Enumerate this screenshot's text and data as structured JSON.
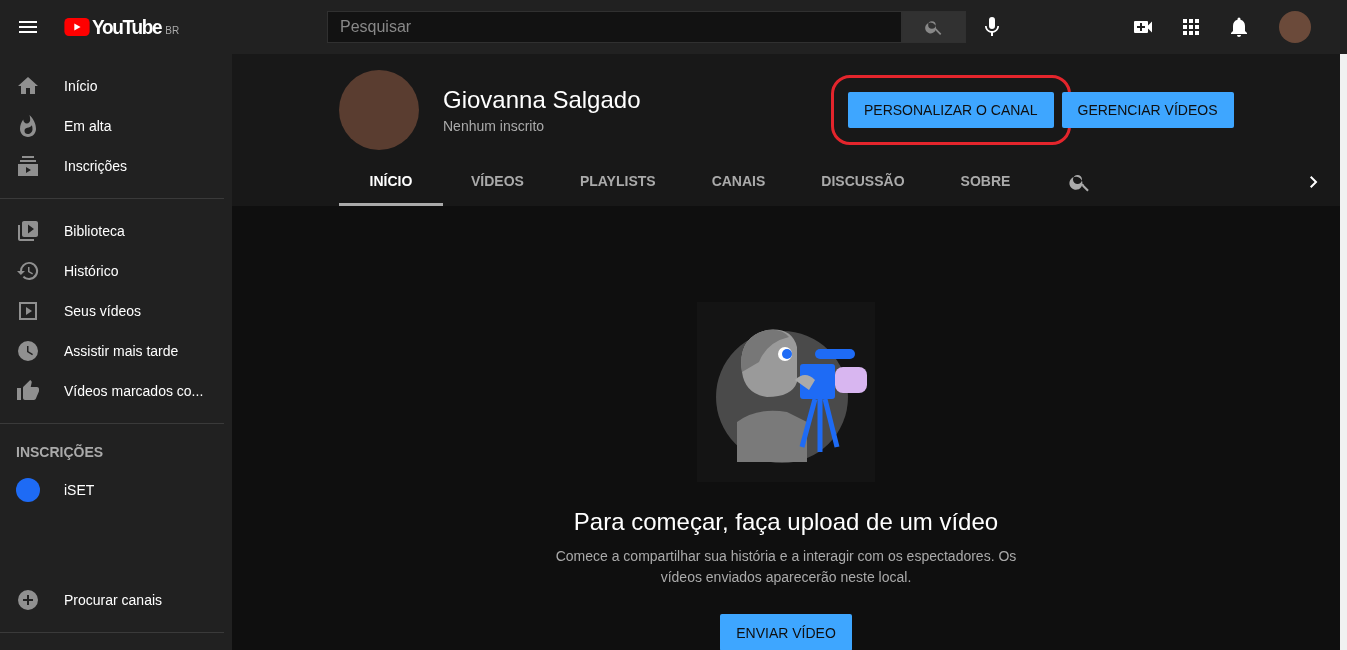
{
  "topbar": {
    "logo_text": "YouTube",
    "region": "BR",
    "search": {
      "placeholder": "Pesquisar"
    }
  },
  "sidebar": {
    "sections": [
      {
        "items": [
          {
            "label": "Início"
          },
          {
            "label": "Em alta"
          },
          {
            "label": "Inscrições"
          }
        ]
      },
      {
        "items": [
          {
            "label": "Biblioteca"
          },
          {
            "label": "Histórico"
          },
          {
            "label": "Seus vídeos"
          },
          {
            "label": "Assistir mais tarde"
          },
          {
            "label": "Vídeos marcados co..."
          }
        ]
      }
    ],
    "subscriptions": {
      "heading": "INSCRIÇÕES",
      "channels": [
        {
          "name": "iSET",
          "color": "#1e6bf5"
        }
      ]
    },
    "browse": {
      "label": "Procurar canais"
    }
  },
  "channel": {
    "name": "Giovanna Salgado",
    "subscribers": "Nenhum inscrito",
    "buttons": [
      {
        "label": "PERSONALIZAR O CANAL",
        "highlighted": true
      },
      {
        "label": "GERENCIAR VÍDEOS",
        "highlighted": false
      }
    ],
    "tabs": [
      {
        "label": "INÍCIO",
        "selected": true
      },
      {
        "label": "VÍDEOS",
        "selected": false
      },
      {
        "label": "PLAYLISTS",
        "selected": false
      },
      {
        "label": "CANAIS",
        "selected": false
      },
      {
        "label": "DISCUSSÃO",
        "selected": false
      },
      {
        "label": "SOBRE",
        "selected": false
      }
    ]
  },
  "empty_state": {
    "title": "Para começar, faça upload de um vídeo",
    "text": "Comece a compartilhar sua história e a interagir com os espectadores. Os vídeos enviados aparecerão neste local.",
    "button": "ENVIAR VÍDEO"
  }
}
